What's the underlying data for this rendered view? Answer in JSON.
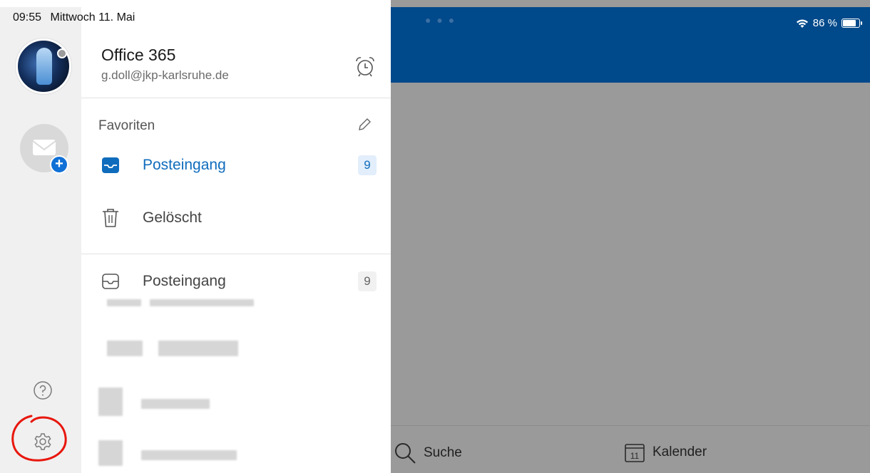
{
  "status_bar": {
    "time": "09:55",
    "date": "Mittwoch 11. Mai",
    "battery_percent": "86 %",
    "battery_level": 0.86
  },
  "account": {
    "name": "Office 365",
    "email": "g.doll@jkp-karlsruhe.de"
  },
  "favorites": {
    "title": "Favoriten",
    "items": [
      {
        "label": "Posteingang",
        "count": "9",
        "icon": "inbox-icon",
        "active": true
      },
      {
        "label": "Gelöscht",
        "count": "",
        "icon": "trash-icon",
        "active": false
      }
    ]
  },
  "folders": [
    {
      "label": "Posteingang",
      "count": "9",
      "icon": "inbox-icon"
    }
  ],
  "tabbar": {
    "search_label": "Suche",
    "calendar_label": "Kalender",
    "calendar_day": "11"
  },
  "colors": {
    "accent": "#0f6cbd",
    "header": "#00498a",
    "overlay": "#9a9a9a",
    "annotation": "#e8160c"
  }
}
